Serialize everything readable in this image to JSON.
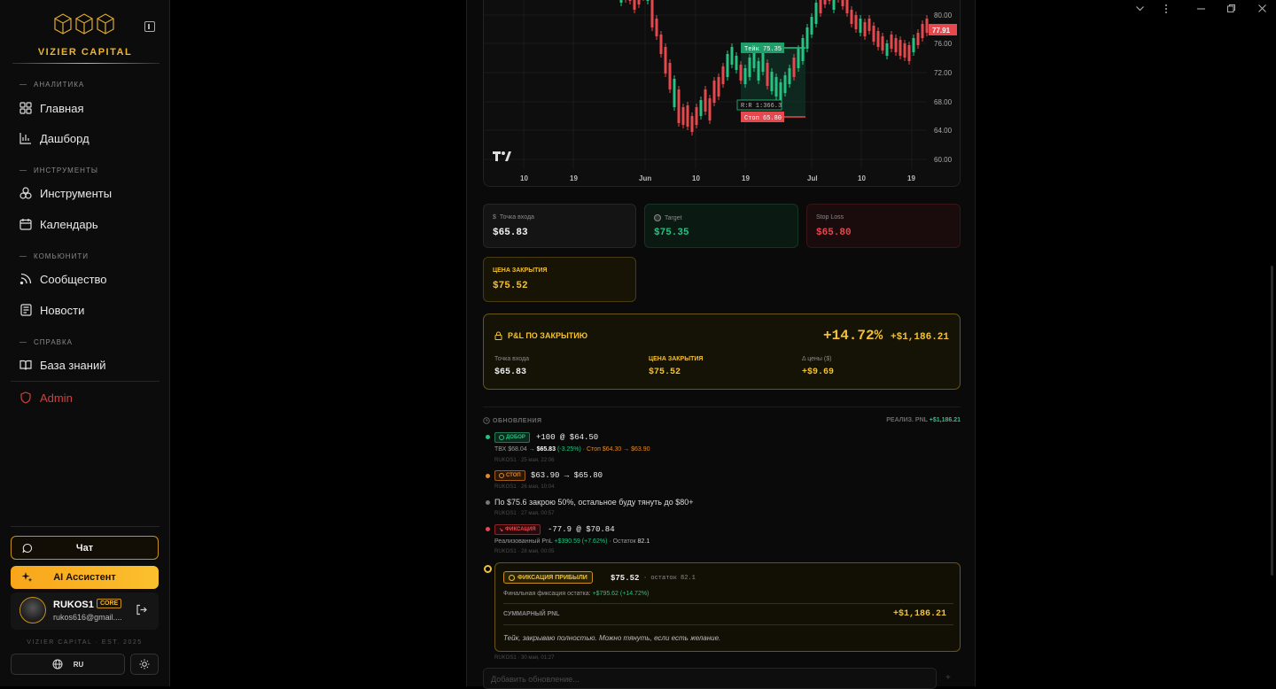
{
  "brand": {
    "name": "VIZIER CAPITAL",
    "est": "VIZIER CAPITAL · EST. 2025",
    "accent": "#f0b52a"
  },
  "sidebar": {
    "sections": [
      {
        "title": "АНАЛИТИКА"
      },
      {
        "title": "ИНСТРУМЕНТЫ"
      },
      {
        "title": "КОМЬЮНИТИ"
      },
      {
        "title": "СПРАВКА"
      }
    ],
    "items": [
      {
        "label": "Главная",
        "icon": "grid-icon"
      },
      {
        "label": "Дашборд",
        "icon": "bar-chart-icon"
      },
      {
        "label": "Инструменты",
        "icon": "tools-icon"
      },
      {
        "label": "Календарь",
        "icon": "calendar-icon"
      },
      {
        "label": "Сообщество",
        "icon": "rss-icon"
      },
      {
        "label": "Новости",
        "icon": "newspaper-icon"
      },
      {
        "label": "База знаний",
        "icon": "book-icon"
      },
      {
        "label": "Admin",
        "icon": "shield-icon"
      }
    ],
    "chat_label": "Чат",
    "ai_label": "AI Ассистент",
    "user": {
      "name": "RUKOS1",
      "badge": "CORE",
      "email": "rukos616@gmail...."
    },
    "lang": "RU"
  },
  "chart": {
    "price_labels": [
      "80.00",
      "76.00",
      "72.00",
      "68.00",
      "64.00",
      "60.00"
    ],
    "current_price": "77.91",
    "x_labels": [
      "10",
      "19",
      "Jun",
      "10",
      "19",
      "Jul",
      "10",
      "19"
    ],
    "take_label": "Тейк 75.35",
    "stop_label": "Стоп 65.80",
    "rr_label": "R:R 1:366.3"
  },
  "levels": {
    "entry": {
      "label": "Точка входа",
      "value": "$65.83"
    },
    "target": {
      "label": "Target",
      "value": "$75.35"
    },
    "stop": {
      "label": "Stop Loss",
      "value": "$65.80"
    },
    "close": {
      "label": "ЦЕНА ЗАКРЫТИЯ",
      "value": "$75.52"
    }
  },
  "pnl": {
    "title": "P&L ПО ЗАКРЫТИЮ",
    "pct": "+14.72%",
    "usd": "+$1,186.21",
    "entry_label": "Точка входа",
    "entry_value": "$65.83",
    "close_label": "ЦЕНА ЗАКРЫТИЯ",
    "close_value": "$75.52",
    "delta_label": "Δ цены ($)",
    "delta_value": "+$9.69"
  },
  "updates": {
    "title": "ОБНОВЛЕНИЯ",
    "realized_label": "РЕАЛИЗ. PNL",
    "realized_value": "+$1,186.21",
    "items": [
      {
        "tag": "ДОБОР",
        "main": "+100 @ $64.50",
        "sub_a": "ТВХ $68.04 →",
        "sub_b": "$65.83",
        "sub_c": "(-3.25%)",
        "sub_d": "· Стоп $64.30 → $63.90",
        "meta": "RUKOS1 · 25 мая, 22:06"
      },
      {
        "tag": "СТОП",
        "main": "$63.90 → $65.80",
        "meta": "RUKOS1 · 26 мая, 10:04"
      },
      {
        "text": "По $75.6 закрою 50%, остальное буду тянуть до $80+",
        "meta": "RUKOS1 · 27 мая, 00:57"
      },
      {
        "tag": "ФИКСАЦИЯ",
        "main": "-77.9 @ $70.84",
        "sub_a": "Реализованный PnL",
        "sub_b": "+$390.59 (+7.62%)",
        "sub_c": "· Остаток",
        "sub_d": "82.1",
        "meta": "RUKOS1 · 28 мая, 00:05"
      }
    ],
    "close": {
      "tag": "ФИКСАЦИЯ ПРИБЫЛИ",
      "price": "$75.52",
      "rest": "· остаток 82.1",
      "final_label": "Финальная фиксация остатка:",
      "final_value": "+$795.62 (+14.72%)",
      "sum_label": "СУММАРНЫЙ PNL",
      "sum_value": "+$1,186.21",
      "comment": "Тейк, закрываю полностью. Можно тянуть, если есть желание.",
      "meta": "RUKOS1 · 30 мая, 01:27"
    },
    "add_placeholder": "Добавить обновление..."
  }
}
